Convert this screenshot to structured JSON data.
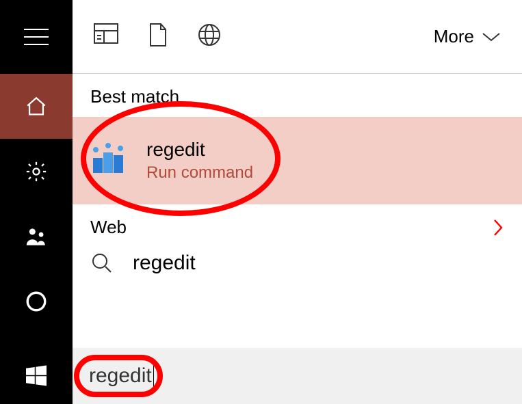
{
  "sidebar": {
    "hamburger": "menu",
    "home": "home",
    "settings": "settings",
    "people": "people",
    "cortana": "cortana",
    "start": "start"
  },
  "topbar": {
    "filter_docs": "page",
    "filter_files": "file",
    "filter_web": "web",
    "more_label": "More"
  },
  "best_match": {
    "header": "Best match",
    "item": {
      "title": "regedit",
      "subtitle": "Run command"
    }
  },
  "web": {
    "header": "Web",
    "item_label": "regedit"
  },
  "search": {
    "value": "regedit"
  }
}
